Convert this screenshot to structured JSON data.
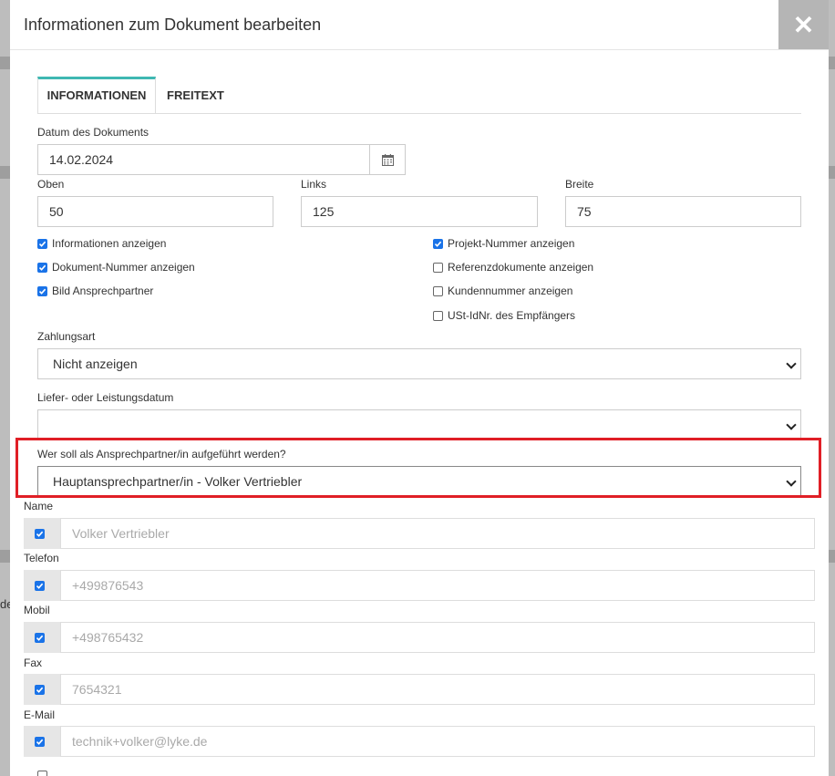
{
  "modal": {
    "title": "Informationen zum Dokument bearbeiten",
    "close_label": "✕"
  },
  "background": {
    "text": "de"
  },
  "tabs": [
    {
      "label": "INFORMATIONEN"
    },
    {
      "label": "FREITEXT"
    }
  ],
  "date": {
    "label": "Datum des Dokuments",
    "value": "14.02.2024"
  },
  "position": {
    "top": {
      "label": "Oben",
      "value": "50"
    },
    "left": {
      "label": "Links",
      "value": "125"
    },
    "width": {
      "label": "Breite",
      "value": "75"
    }
  },
  "checkboxes_left": [
    {
      "label": "Informationen anzeigen",
      "checked": true
    },
    {
      "label": "Dokument-Nummer anzeigen",
      "checked": true
    },
    {
      "label": "Bild Ansprechpartner",
      "checked": true
    }
  ],
  "checkboxes_right": [
    {
      "label": "Projekt-Nummer anzeigen",
      "checked": true
    },
    {
      "label": "Referenzdokumente anzeigen",
      "checked": false
    },
    {
      "label": "Kundennummer anzeigen",
      "checked": false
    },
    {
      "label": "USt-IdNr. des Empfängers",
      "checked": false
    }
  ],
  "payment": {
    "label": "Zahlungsart",
    "value": "Nicht anzeigen"
  },
  "delivery_date": {
    "label": "Liefer- oder Leistungsdatum",
    "value": ""
  },
  "contact_person": {
    "label": "Wer soll als Ansprechpartner/in aufgeführt werden?",
    "value": "Hauptansprechpartner/in - Volker Vertriebler"
  },
  "contact_fields": [
    {
      "label": "Name",
      "value": "Volker Vertriebler",
      "checked": true
    },
    {
      "label": "Telefon",
      "value": "+499876543",
      "checked": true
    },
    {
      "label": "Mobil",
      "value": "+498765432",
      "checked": true
    },
    {
      "label": "Fax",
      "value": "7654321",
      "checked": true
    },
    {
      "label": "E-Mail",
      "value": "technik+volker@lyke.de",
      "checked": true
    }
  ],
  "colors": {
    "accent": "#3fb8b2",
    "checkbox": "#1a73e8",
    "highlight": "#e01f26"
  }
}
